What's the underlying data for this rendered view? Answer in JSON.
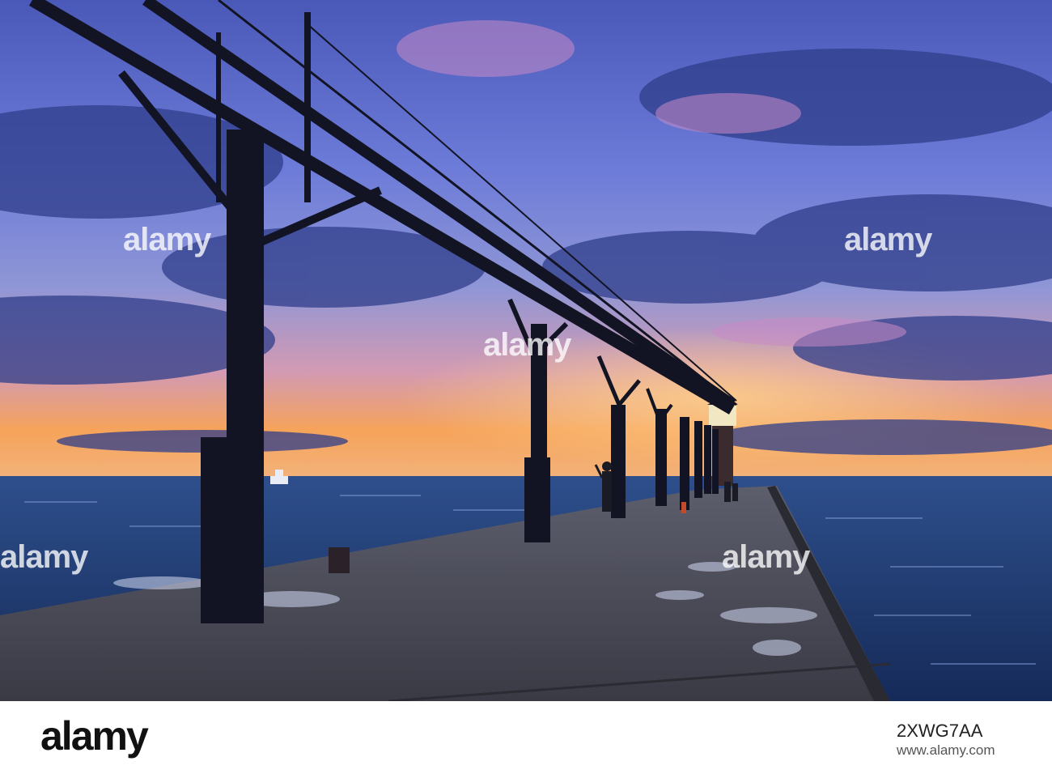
{
  "watermark": {
    "text": "alamy"
  },
  "footer": {
    "logo": "alamy",
    "image_id": "2XWG7AA",
    "site": "www.alamy.com"
  },
  "colors": {
    "sky_top": "#5a63c4",
    "sky_horizon": "#f7a35a",
    "water": "#233d74",
    "pier": "#4a4a57",
    "silhouette": "#121424",
    "lighthouse_light": "#f2e7c3"
  }
}
